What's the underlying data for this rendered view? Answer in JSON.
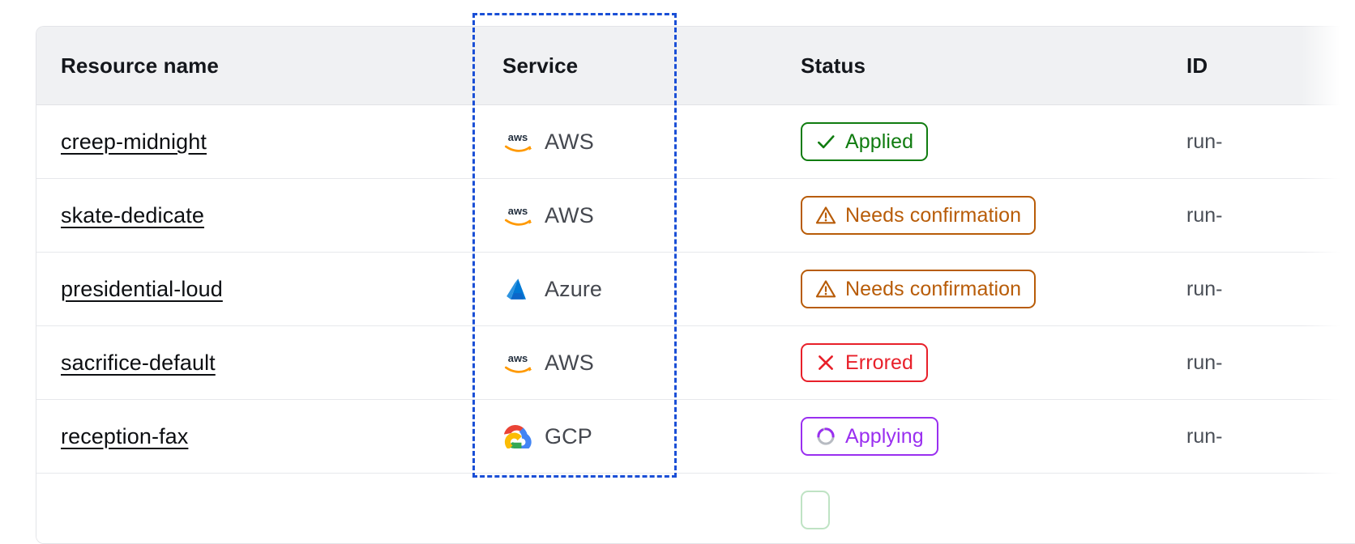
{
  "table": {
    "columns": [
      {
        "key": "name",
        "label": "Resource name"
      },
      {
        "key": "service",
        "label": "Service"
      },
      {
        "key": "status",
        "label": "Status"
      },
      {
        "key": "id",
        "label": "ID"
      }
    ],
    "rows": [
      {
        "name": "creep-midnight",
        "service": "AWS",
        "service_icon": "aws-logo-icon",
        "status": "Applied",
        "status_icon": "check-icon",
        "status_variant": "applied",
        "id": "run-"
      },
      {
        "name": "skate-dedicate",
        "service": "AWS",
        "service_icon": "aws-logo-icon",
        "status": "Needs confirmation",
        "status_icon": "warning-triangle-icon",
        "status_variant": "needs",
        "id": "run-"
      },
      {
        "name": "presidential-loud",
        "service": "Azure",
        "service_icon": "azure-logo-icon",
        "status": "Needs confirmation",
        "status_icon": "warning-triangle-icon",
        "status_variant": "needs",
        "id": "run-"
      },
      {
        "name": "sacrifice-default",
        "service": "AWS",
        "service_icon": "aws-logo-icon",
        "status": "Errored",
        "status_icon": "x-icon",
        "status_variant": "errored",
        "id": "run-"
      },
      {
        "name": "reception-fax",
        "service": "GCP",
        "service_icon": "gcp-logo-icon",
        "status": "Applying",
        "status_icon": "spinner-icon",
        "status_variant": "applying",
        "id": "run-"
      },
      {
        "name": "",
        "service": "",
        "service_icon": "",
        "status": "",
        "status_icon": "",
        "status_variant": "pending",
        "id": ""
      }
    ]
  },
  "selection": {
    "name": "service-column-selection",
    "color": "#1a4fd6",
    "style": "dashed"
  },
  "colors": {
    "header_background": "#f0f1f3",
    "row_border": "#e7e8ec",
    "link_text": "#0d0f12",
    "applied": "#107c10",
    "needs_confirmation": "#b85c08",
    "errored": "#e8202a",
    "applying": "#9a2ff0",
    "selection_blue": "#1a4fd6"
  }
}
